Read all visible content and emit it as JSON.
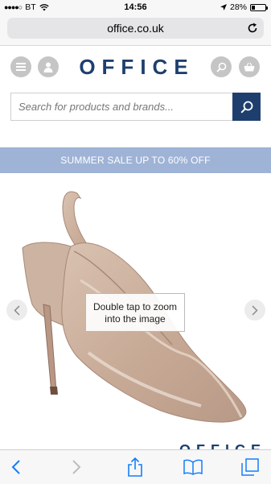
{
  "status_bar": {
    "carrier": "BT",
    "time": "14:56",
    "battery_percent": "28%",
    "battery_level": 0.28
  },
  "browser": {
    "url": "office.co.uk"
  },
  "header": {
    "logo_text": "OFFICE"
  },
  "search": {
    "placeholder": "Search for products and brands..."
  },
  "promo": {
    "text": "SUMMER SALE UP TO 60% OFF"
  },
  "product": {
    "zoom_tooltip": "Double tap to zoom into the image",
    "watermark": "OFFICE"
  },
  "icons": {
    "menu": "hamburger-menu-icon",
    "account": "user-icon",
    "search": "magnifier-icon",
    "basket": "basket-icon",
    "back": "chevron-left-icon",
    "forward": "chevron-right-icon",
    "share": "share-icon",
    "bookmarks": "open-book-icon",
    "tabs": "tabs-icon"
  },
  "colors": {
    "brand": "#1e3f6e",
    "promo_bg": "#9fb3d6",
    "ios_blue": "#147efb"
  }
}
